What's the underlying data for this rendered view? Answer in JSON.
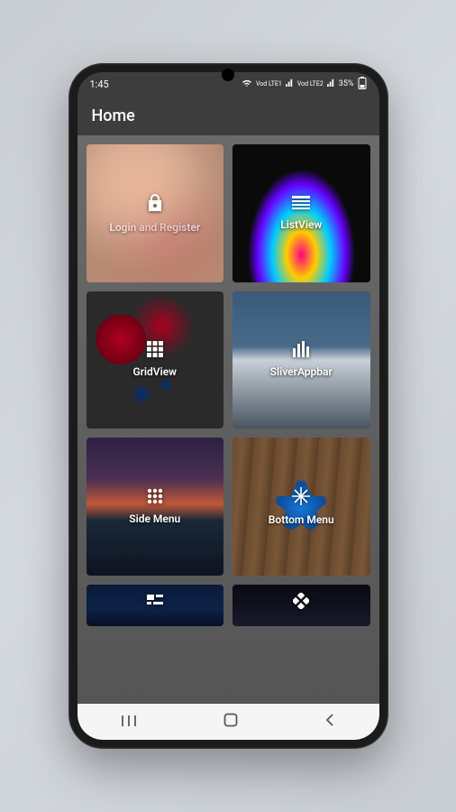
{
  "status": {
    "time": "1:45",
    "network1": "Vod LTE1",
    "network2": "Vod LTE2",
    "battery": "35%"
  },
  "appbar": {
    "title": "Home"
  },
  "tiles": [
    {
      "label": "Login and Register"
    },
    {
      "label": "ListView"
    },
    {
      "label": "GridView"
    },
    {
      "label": "SliverAppbar"
    },
    {
      "label": "Side Menu"
    },
    {
      "label": "Bottom Menu"
    },
    {
      "label": ""
    },
    {
      "label": ""
    }
  ]
}
